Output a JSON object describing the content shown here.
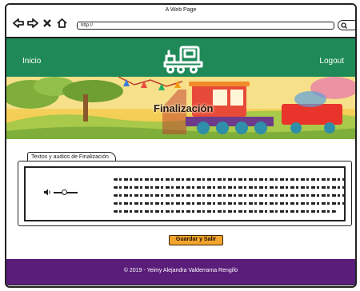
{
  "browser": {
    "window_title": "A Web Page",
    "url": "http://"
  },
  "header": {
    "home_label": "Inicio",
    "logout_label": "Logout",
    "logo_icon": "train-icon",
    "color": "#1f8a58"
  },
  "banner": {
    "title": "Finalización"
  },
  "content": {
    "tab_label": "Textos y audios de Finalización",
    "audio_icon": "speaker-icon",
    "text_lines": 5
  },
  "actions": {
    "save_label": "Guardar y Salir",
    "save_color": "#f2a42c"
  },
  "footer": {
    "copyright": "© 2019 - Yeimy Alejandra Valderrama Rengifo",
    "color": "#5a1d7a"
  }
}
